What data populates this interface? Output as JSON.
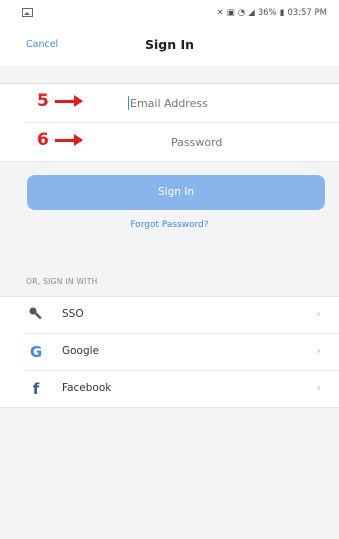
{
  "status_bar": {
    "battery_percent": "36%",
    "time": "03:57 PM"
  },
  "nav": {
    "cancel_label": "Cancel",
    "title": "Sign In"
  },
  "form": {
    "email_placeholder": "Email Address",
    "email_value": "",
    "password_placeholder": "Password",
    "password_value": "",
    "annotations": {
      "email_step": "5",
      "password_step": "6",
      "color": "#e21b1b"
    }
  },
  "signin_button": {
    "label": "Sign In",
    "color": "#88b5ec"
  },
  "forgot_password_label": "Forgot Password?",
  "or_section_label": "OR, SIGN IN WITH",
  "providers": [
    {
      "label": "SSO",
      "icon": "key-icon"
    },
    {
      "label": "Google",
      "icon": "google-icon"
    },
    {
      "label": "Facebook",
      "icon": "facebook-icon"
    }
  ],
  "colors": {
    "accent": "#3d8be0",
    "background": "#f3f4f6"
  }
}
